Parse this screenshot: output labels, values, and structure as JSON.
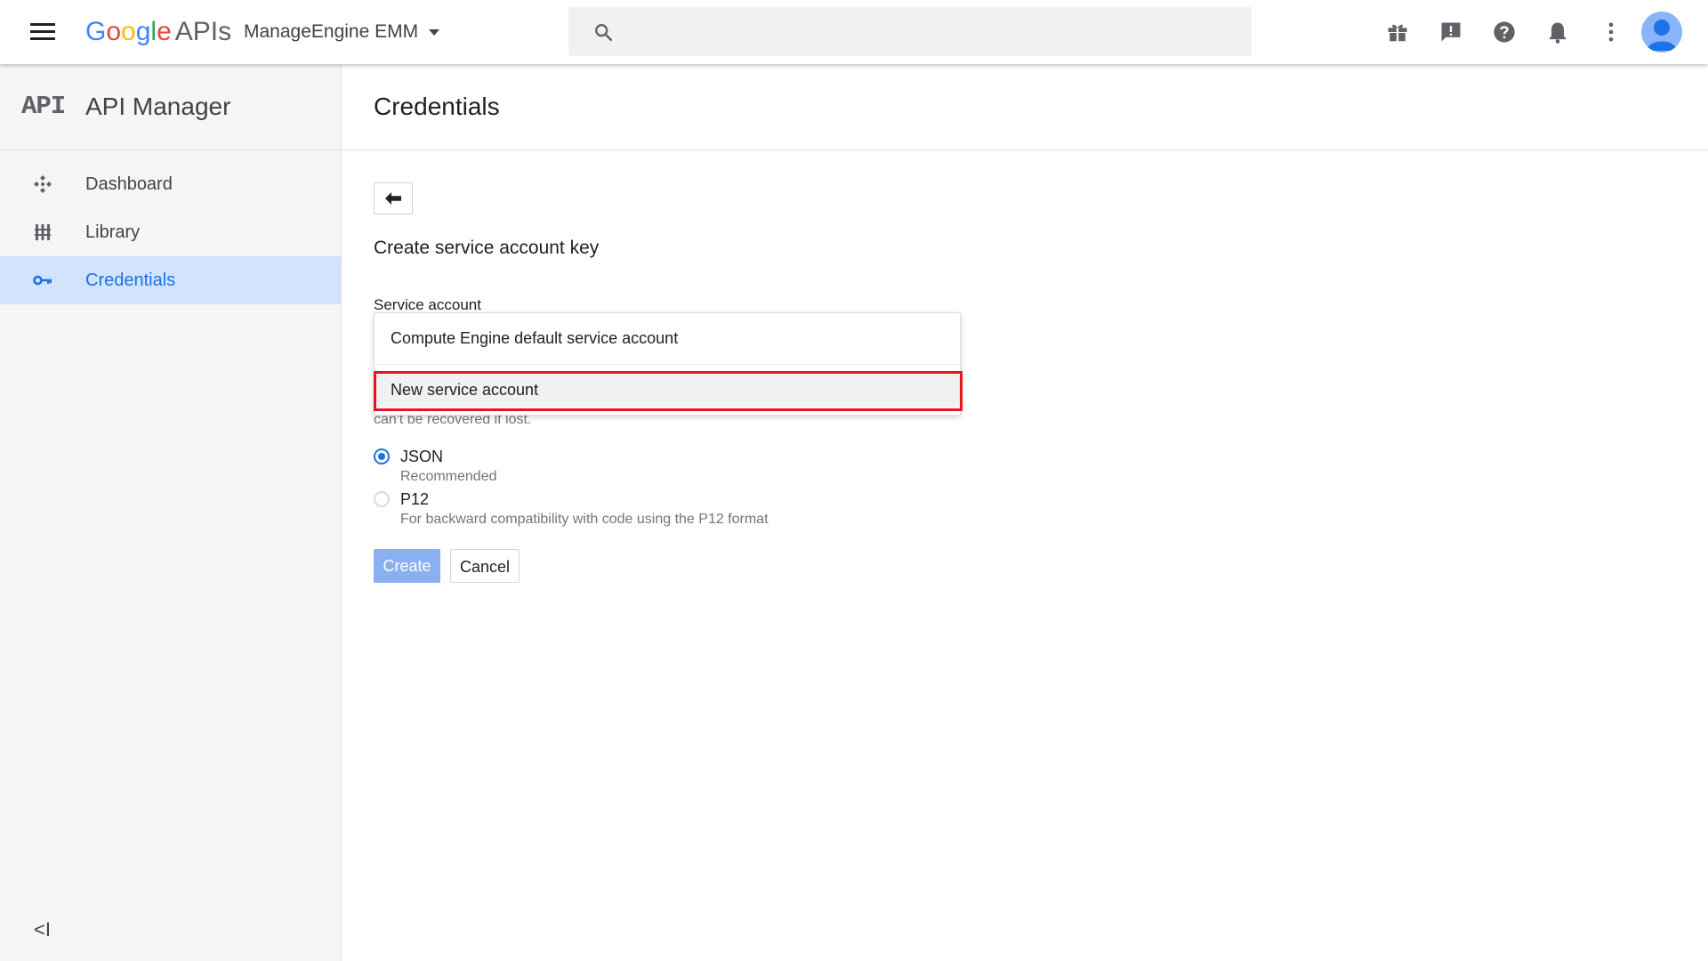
{
  "topbar": {
    "logo_letters": [
      {
        "ch": "G",
        "color": "#4285F4"
      },
      {
        "ch": "o",
        "color": "#EA4335"
      },
      {
        "ch": "o",
        "color": "#FBBC05"
      },
      {
        "ch": "g",
        "color": "#4285F4"
      },
      {
        "ch": "l",
        "color": "#34A853"
      },
      {
        "ch": "e",
        "color": "#EA4335"
      }
    ],
    "logo_suffix": "APIs",
    "project_name": "ManageEngine EMM",
    "search_value": "",
    "icons": [
      "gift-icon",
      "feedback-icon",
      "help-icon",
      "notifications-icon",
      "more-vert-icon",
      "account-avatar"
    ]
  },
  "sidebar": {
    "brand_mark": "API",
    "title": "API Manager",
    "items": [
      {
        "label": "Dashboard",
        "icon": "dashboard-icon",
        "active": false
      },
      {
        "label": "Library",
        "icon": "library-icon",
        "active": false
      },
      {
        "label": "Credentials",
        "icon": "key-icon",
        "active": true
      }
    ],
    "collapse_icon": "<I"
  },
  "main": {
    "page_title": "Credentials",
    "section_title": "Create service account key",
    "service_account_label": "Service account",
    "dropdown_options": [
      {
        "label": "Compute Engine default service account"
      },
      {
        "label": "New service account",
        "highlighted": true
      }
    ],
    "key_hint": "can't be recovered if lost.",
    "key_types": [
      {
        "label": "JSON",
        "sub": "Recommended",
        "selected": true
      },
      {
        "label": "P12",
        "sub": "For backward compatibility with code using the P12 format",
        "selected": false
      }
    ],
    "create_label": "Create",
    "cancel_label": "Cancel"
  },
  "colors": {
    "accent": "#1a73e8",
    "active_nav_bg": "#d2e3fc",
    "highlight_box": "#e8141e",
    "create_button_disabled": "#8ab0f2"
  }
}
